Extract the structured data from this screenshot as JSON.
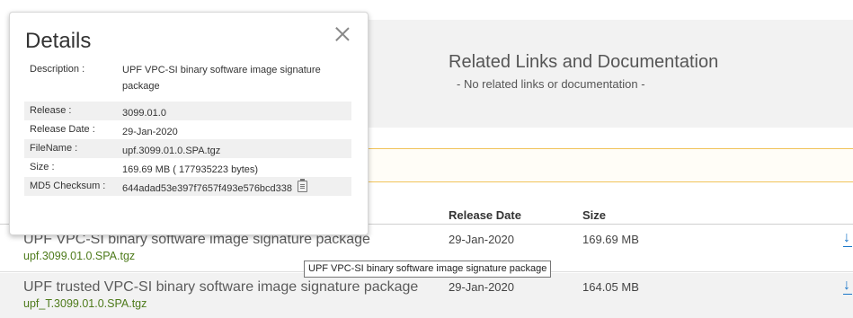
{
  "related": {
    "title": "Related Links and Documentation",
    "subtitle": "- No related links or documentation -"
  },
  "table": {
    "headers": {
      "release_date": "Release Date",
      "size": "Size"
    },
    "rows": [
      {
        "title": "UPF VPC-SI binary software image signature package",
        "file": "upf.3099.01.0.SPA.tgz",
        "date": "29-Jan-2020",
        "size": "169.69 MB",
        "download_icon": "download-icon"
      },
      {
        "title": "UPF trusted VPC-SI binary software image signature package",
        "file": "upf_T.3099.01.0.SPA.tgz",
        "date": "29-Jan-2020",
        "size": "164.05 MB",
        "download_icon": "download-icon"
      }
    ]
  },
  "tooltip": "UPF VPC-SI binary software image signature package",
  "details": {
    "title": "Details",
    "close_icon": "close-icon",
    "rows": [
      {
        "label": "Description :",
        "value": "UPF VPC-SI binary software image signature package"
      },
      {
        "label": "Release :",
        "value": "3099.01.0"
      },
      {
        "label": "Release Date :",
        "value": "29-Jan-2020"
      },
      {
        "label": "FileName :",
        "value": "upf.3099.01.0.SPA.tgz"
      },
      {
        "label": "Size :",
        "value": "169.69 MB ( 177935223 bytes)"
      },
      {
        "label": "MD5 Checksum :",
        "value": "644adad53e397f7657f493e576bcd338"
      }
    ],
    "copy_icon": "copy-icon"
  },
  "colors": {
    "file_link": "#4d7a1a",
    "download_accent": "#1a77c9",
    "notice_border": "#f1c35b"
  }
}
